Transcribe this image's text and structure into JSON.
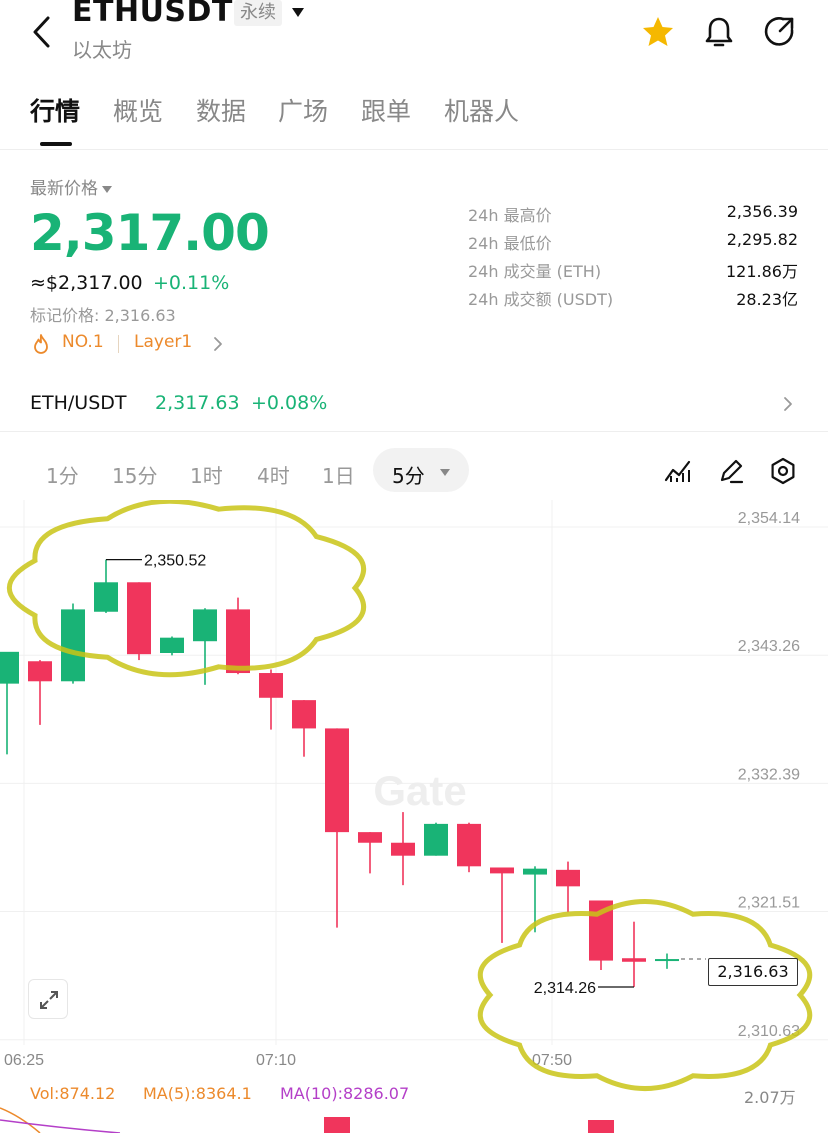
{
  "header": {
    "title": "ETHUSDT",
    "tag": "永续",
    "subtitle": "以太坊",
    "icons": [
      "back-icon",
      "star-icon",
      "bell-icon",
      "share-icon"
    ],
    "star_color": "#f5b800"
  },
  "tabs": [
    "行情",
    "概览",
    "数据",
    "广场",
    "跟单",
    "机器人"
  ],
  "active_tab": "行情",
  "summary": {
    "latest_label": "最新价格",
    "price": "2,317.00",
    "usd_price": "≈$2,317.00",
    "change_pct": "+0.11%",
    "mark_price": "标记价格: 2,316.63",
    "tag_rank": "NO.1",
    "tag_category": "Layer1"
  },
  "stats": [
    {
      "label": "24h 最高价",
      "value": "2,356.39"
    },
    {
      "label": "24h 最低价",
      "value": "2,295.82"
    },
    {
      "label": "24h 成交量 (ETH)",
      "value": "121.86万"
    },
    {
      "label": "24h 成交额 (USDT)",
      "value": "28.23亿"
    }
  ],
  "pair_row": {
    "name": "ETH/USDT",
    "price": "2,317.63",
    "change": "+0.08%"
  },
  "intervals": [
    "1分",
    "15分",
    "1时",
    "4时",
    "1日"
  ],
  "active_interval": "5分",
  "chart_tools": [
    "indicator-icon",
    "draw-icon",
    "settings-icon"
  ],
  "colors": {
    "up": "#19b376",
    "down": "#f0355c",
    "accent": "#19b376"
  },
  "chart_data": {
    "type": "candlestick",
    "watermark": "Gate",
    "y_ticks": [
      "2,354.14",
      "2,343.26",
      "2,332.39",
      "2,321.51",
      "2,310.63"
    ],
    "y_tick_values": [
      2354.14,
      2343.26,
      2332.39,
      2321.51,
      2310.63
    ],
    "x_ticks": [
      "06:25",
      "07:10",
      "07:50"
    ],
    "high_label": "2,350.52",
    "low_label": "2,314.26",
    "current_label": "2,316.63",
    "candles": [
      {
        "o": 2340.0,
        "h": 2341.0,
        "l": 2334.0,
        "c": 2342.7
      },
      {
        "o": 2341.9,
        "h": 2342.0,
        "l": 2336.5,
        "c": 2340.2
      },
      {
        "o": 2340.2,
        "h": 2346.8,
        "l": 2340.0,
        "c": 2346.3
      },
      {
        "o": 2346.1,
        "h": 2350.52,
        "l": 2346.0,
        "c": 2348.6
      },
      {
        "o": 2348.6,
        "h": 2348.6,
        "l": 2342.0,
        "c": 2342.5
      },
      {
        "o": 2342.6,
        "h": 2344.0,
        "l": 2342.4,
        "c": 2343.9
      },
      {
        "o": 2343.6,
        "h": 2346.4,
        "l": 2339.9,
        "c": 2346.3
      },
      {
        "o": 2346.3,
        "h": 2347.3,
        "l": 2340.8,
        "c": 2340.9
      },
      {
        "o": 2340.9,
        "h": 2341.2,
        "l": 2336.1,
        "c": 2338.8
      },
      {
        "o": 2338.6,
        "h": 2338.6,
        "l": 2333.8,
        "c": 2336.2
      },
      {
        "o": 2336.2,
        "h": 2336.2,
        "l": 2319.3,
        "c": 2327.4
      },
      {
        "o": 2327.4,
        "h": 2327.4,
        "l": 2323.9,
        "c": 2326.5
      },
      {
        "o": 2326.5,
        "h": 2329.1,
        "l": 2322.9,
        "c": 2325.4
      },
      {
        "o": 2325.4,
        "h": 2328.2,
        "l": 2325.4,
        "c": 2328.1
      },
      {
        "o": 2328.1,
        "h": 2328.2,
        "l": 2324.0,
        "c": 2324.5
      },
      {
        "o": 2324.4,
        "h": 2324.4,
        "l": 2318.0,
        "c": 2323.9
      },
      {
        "o": 2323.8,
        "h": 2324.5,
        "l": 2318.9,
        "c": 2324.3
      },
      {
        "o": 2324.2,
        "h": 2324.9,
        "l": 2320.6,
        "c": 2322.8
      },
      {
        "o": 2321.6,
        "h": 2321.6,
        "l": 2315.7,
        "c": 2316.5
      },
      {
        "o": 2316.7,
        "h": 2319.8,
        "l": 2314.26,
        "c": 2316.4
      },
      {
        "o": 2316.6,
        "h": 2317.1,
        "l": 2315.8,
        "c": 2316.63
      }
    ],
    "volume_labels": {
      "vol": "Vol:874.12",
      "ma5": "MA(5):8364.1",
      "ma10": "MA(10):8286.07",
      "axis": "2.07万"
    },
    "volume_colors": {
      "vol": "#ec8a2c",
      "ma5": "#ec8a2c",
      "ma10": "#b43fc8"
    }
  }
}
